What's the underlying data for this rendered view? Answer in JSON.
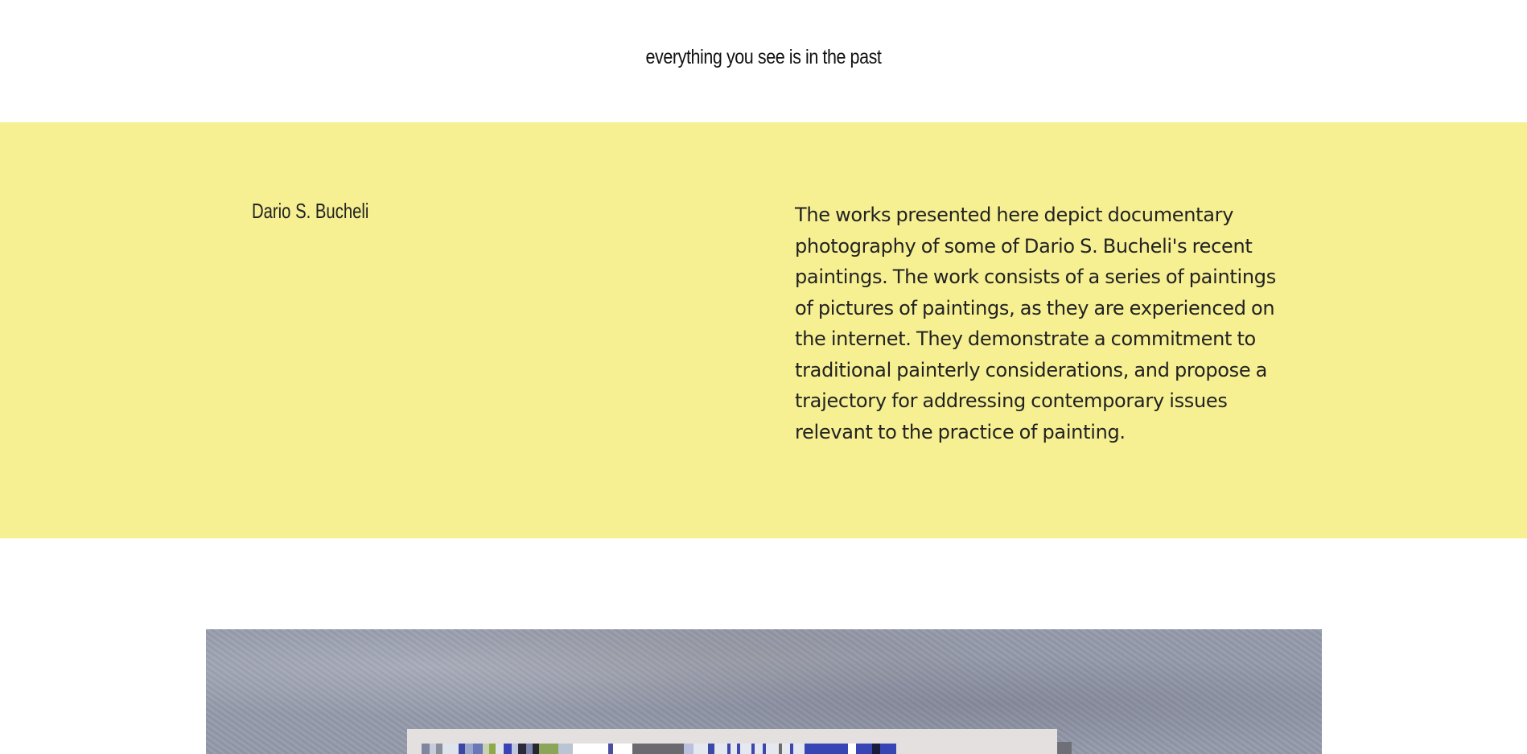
{
  "header": {
    "tagline": "everything you see is in the past"
  },
  "intro": {
    "artist_name": "Dario S. Bucheli",
    "description": "The works presented here depict documentary photography of some of Dario S. Bucheli's recent paintings. The work consists of a series of paintings of pictures of paintings, as they are experienced on the internet. They demonstrate a commitment to traditional painterly considerations, and propose a trajectory for addressing contemporary issues relevant to the practice of painting.",
    "background_color": "#f6f093"
  },
  "gallery": {
    "image_subject": "photograph of a striped painting on a concrete wall"
  }
}
